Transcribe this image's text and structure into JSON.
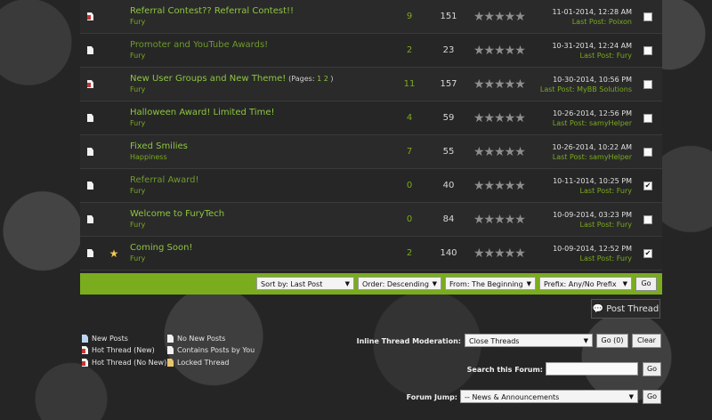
{
  "threads": [
    {
      "icon": "hot-thread-icon",
      "hot": true,
      "star": false,
      "title": "Referral Contest?? Referral Contest!!",
      "read": false,
      "pages": null,
      "author": "Fury",
      "replies": "9",
      "views": "151",
      "date": "11-01-2014, 12:28 AM",
      "lastpost_label": "Last Post:",
      "lastpost_user": "Poixon",
      "checked": false
    },
    {
      "icon": "thread-icon",
      "hot": false,
      "star": false,
      "title": "Promoter and YouTube Awards!",
      "read": true,
      "pages": null,
      "author": "Fury",
      "replies": "2",
      "views": "23",
      "date": "10-31-2014, 12:24 AM",
      "lastpost_label": "Last Post:",
      "lastpost_user": "Fury",
      "checked": false
    },
    {
      "icon": "hot-thread-icon",
      "hot": true,
      "star": false,
      "title": "New User Groups and New Theme!",
      "read": false,
      "pages": {
        "label": "(Pages:",
        "p1": "1",
        "p2": "2",
        "close": ")"
      },
      "author": "Fury",
      "replies": "11",
      "views": "157",
      "date": "10-30-2014, 10:56 PM",
      "lastpost_label": "Last Post:",
      "lastpost_user": "MyBB Solutions",
      "checked": false
    },
    {
      "icon": "thread-icon",
      "hot": false,
      "star": false,
      "title": "Halloween Award! Limited Time!",
      "read": false,
      "pages": null,
      "author": "Fury",
      "replies": "4",
      "views": "59",
      "date": "10-26-2014, 12:56 PM",
      "lastpost_label": "Last Post:",
      "lastpost_user": "samyHelper",
      "checked": false
    },
    {
      "icon": "thread-icon",
      "hot": false,
      "star": false,
      "title": "Fixed Smilies",
      "read": false,
      "pages": null,
      "author": "Happiness",
      "replies": "7",
      "views": "55",
      "date": "10-26-2014, 10:22 AM",
      "lastpost_label": "Last Post:",
      "lastpost_user": "samyHelper",
      "checked": false
    },
    {
      "icon": "thread-icon",
      "hot": false,
      "star": false,
      "title": "Referral Award!",
      "read": true,
      "pages": null,
      "author": "Fury",
      "replies": "0",
      "views": "40",
      "date": "10-11-2014, 10:25 PM",
      "lastpost_label": "Last Post:",
      "lastpost_user": "Fury",
      "checked": true
    },
    {
      "icon": "thread-icon",
      "hot": false,
      "star": false,
      "title": "Welcome to FuryTech",
      "read": false,
      "pages": null,
      "author": "Fury",
      "replies": "0",
      "views": "84",
      "date": "10-09-2014, 03:23 PM",
      "lastpost_label": "Last Post:",
      "lastpost_user": "Fury",
      "checked": false
    },
    {
      "icon": "thread-icon",
      "hot": false,
      "star": true,
      "title": "Coming Soon!",
      "read": false,
      "pages": null,
      "author": "Fury",
      "replies": "2",
      "views": "140",
      "date": "10-09-2014, 12:52 PM",
      "lastpost_label": "Last Post:",
      "lastpost_user": "Fury",
      "checked": true
    }
  ],
  "rating_stars": "★★★★★",
  "sortbar": {
    "sort_by": "Sort by: Last Post",
    "order": "Order: Descending",
    "from": "From: The Beginning",
    "prefix": "Prefix: Any/No Prefix",
    "go": "Go"
  },
  "post_thread": "Post Thread",
  "legend": {
    "new_posts": "New Posts",
    "hot_new": "Hot Thread (New)",
    "hot_no_new": "Hot Thread (No New)",
    "no_new_posts": "No New Posts",
    "contains_posts": "Contains Posts by You",
    "locked": "Locked Thread"
  },
  "moderation": {
    "label": "Inline Thread Moderation:",
    "selected": "Close Threads",
    "go": "Go (0)",
    "clear": "Clear"
  },
  "search": {
    "label": "Search this Forum:",
    "go": "Go"
  },
  "jump": {
    "label": "Forum Jump:",
    "selected": "-- News & Announcements",
    "go": "Go"
  },
  "colors": {
    "accent": "#8dc63f",
    "bar": "#7aac1e"
  }
}
